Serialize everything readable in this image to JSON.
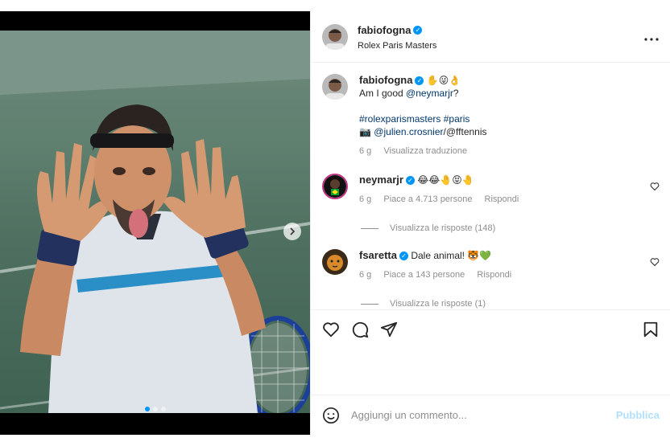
{
  "post": {
    "author": "fabiofogna",
    "location": "Rolex Paris Masters",
    "caption": {
      "author": "fabiofogna",
      "emojis": "✋😜👌",
      "line1_prefix": "Am I good ",
      "line1_mention": "@neymarjr",
      "line1_suffix": "?",
      "hashtag1": "#rolexparismasters",
      "hashtag2": "#paris",
      "camera_emoji": "📷",
      "photo_mention": "@julien.crosnier",
      "photo_suffix": "/@fftennis",
      "time": "6 g",
      "translate": "Visualizza traduzione"
    },
    "comments": [
      {
        "author": "neymarjr",
        "text": "😂😂🤚😝🤚",
        "time": "6 g",
        "likes": "Piace a 4.713 persone",
        "reply": "Rispondi",
        "view_replies": "Visualizza le risposte (148)"
      },
      {
        "author": "fsaretta",
        "text": "Dale animal! 🐯💚",
        "time": "6 g",
        "likes": "Piace a 143 persone",
        "reply": "Rispondi",
        "view_replies": "Visualizza le risposte (1)"
      }
    ]
  },
  "composer": {
    "placeholder": "Aggiungi un commento...",
    "publish": "Pubblica"
  },
  "carousel": {
    "slides": 3,
    "active_index": 0
  },
  "colors": {
    "accent": "#0095f6",
    "link": "#00376b",
    "muted": "#8e8e8e",
    "publish_disabled": "#b2dffc"
  }
}
